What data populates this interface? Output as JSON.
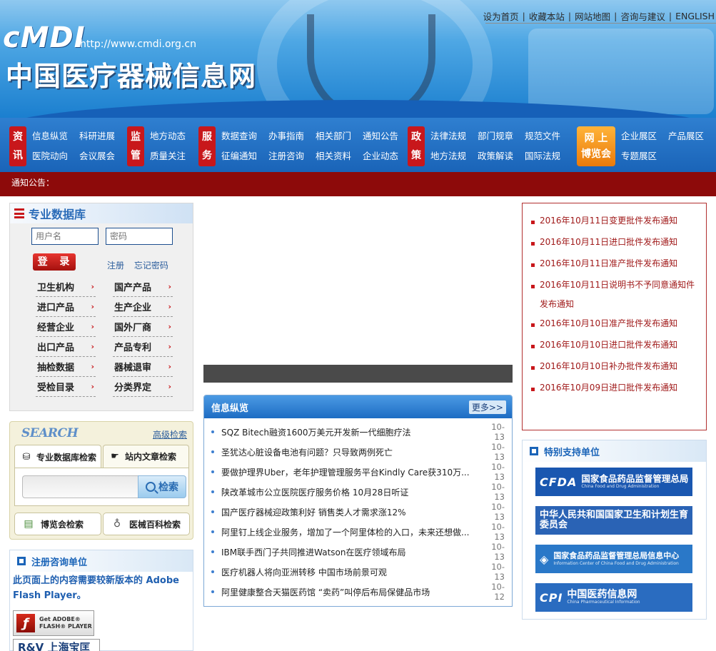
{
  "header": {
    "logo": "cMDI",
    "url": "http://www.cmdi.org.cn",
    "title": "中国医疗器械信息网",
    "top_links": [
      "设为首页",
      "收藏本站",
      "网站地图",
      "咨询与建议",
      "ENGLISH"
    ]
  },
  "nav": {
    "groups": [
      {
        "tag": [
          "资",
          "讯"
        ],
        "links": [
          "信息纵览",
          "医院动向",
          "科研进展",
          "会议展会"
        ]
      },
      {
        "tag": [
          "监",
          "管"
        ],
        "links": [
          "地方动态",
          "质量关注"
        ]
      },
      {
        "tag": [
          "服",
          "务"
        ],
        "links": [
          "数据查询",
          "征编通知",
          "办事指南",
          "注册咨询",
          "相关部门",
          "相关资料",
          "通知公告",
          "企业动态"
        ]
      },
      {
        "tag": [
          "政",
          "策"
        ],
        "links": [
          "法律法规",
          "地方法规",
          "部门规章",
          "政策解读",
          "规范文件",
          "国际法规"
        ]
      },
      {
        "tag": [
          "网 上",
          "博览会"
        ],
        "links": [
          "企业展区",
          "专题展区",
          "产品展区"
        ]
      }
    ]
  },
  "notice_bar": "通知公告：",
  "database": {
    "title": "专业数据库",
    "username_placeholder": "用户名",
    "password_placeholder": "密码",
    "login_label": "登 录",
    "register_label": "注册",
    "forgot_label": "忘记密码",
    "items": [
      "卫生机构",
      "国产产品",
      "进口产品",
      "生产企业",
      "经营企业",
      "国外厂商",
      "出口产品",
      "产品专利",
      "抽检数据",
      "器械退审",
      "受检目录",
      "分类界定"
    ]
  },
  "search": {
    "title": "SEARCH",
    "advanced": "高级检索",
    "tab_db": "专业数据库检索",
    "tab_site": "站内文章检索",
    "button": "检索",
    "expo_search": "博览会检索",
    "encyclopedia_search": "医械百科检索"
  },
  "consult": {
    "title": "注册咨询单位",
    "flash_msg": "此页面上的内容需要较新版本的 Adobe Flash Player。",
    "flash_badge_line1": "Get ADOBE®",
    "flash_badge_line2": "FLASH® PLAYER",
    "next_partner": "R&V 上海宝匡"
  },
  "news": {
    "title": "信息纵览",
    "more": "更多>>",
    "items": [
      {
        "title": "SQZ Bitech融资1600万美元开发新一代细胞疗法",
        "date": "10-13"
      },
      {
        "title": "圣犹达心脏设备电池有问题？只导致两例死亡",
        "date": "10-13"
      },
      {
        "title": "要做护理界Uber，老年护理管理服务平台Kindly Care获310万...",
        "date": "10-13"
      },
      {
        "title": "陕改革城市公立医院医疗服务价格 10月28日听证",
        "date": "10-13"
      },
      {
        "title": "国产医疗器械迎政策利好 销售类人才需求涨12%",
        "date": "10-13"
      },
      {
        "title": "阿里钉上线企业服务，增加了一个阿里体检的入口，未来还想做...",
        "date": "10-13"
      },
      {
        "title": "IBM联手西门子共同推进Watson在医疗领域布局",
        "date": "10-13"
      },
      {
        "title": "医疗机器人将向亚洲转移 中国市场前景可观",
        "date": "10-13"
      },
      {
        "title": "阿里健康整合天猫医药馆 “卖药”叫停后布局保健品市场",
        "date": "10-12"
      }
    ]
  },
  "notices": [
    "2016年10月11日变更批件发布通知",
    "2016年10月11日进口批件发布通知",
    "2016年10月11日准产批件发布通知",
    "2016年10月11日说明书不予同意通知件发布通知",
    "2016年10月10日准产批件发布通知",
    "2016年10月10日进口批件发布通知",
    "2016年10月10日补办批件发布通知",
    "2016年10月09日进口批件发布通知"
  ],
  "support": {
    "title": "特别支持单位",
    "partners": [
      {
        "logo": "CFDA",
        "name": "国家食品药品监督管理总局",
        "sub": "China Food and Drug Administration",
        "color": "#1a57b0"
      },
      {
        "logo": "",
        "name": "中华人民共和国国家卫生和计划生育委员会",
        "sub": "",
        "color": "#2a63b5"
      },
      {
        "logo": "",
        "name": "国家食品药品监督管理总局信息中心",
        "sub": "Information Center of China Food and Drug Administration",
        "color": "#2a78c8"
      },
      {
        "logo": "CPI",
        "name": "中国医药信息网",
        "sub": "China Pharmaceutical Information",
        "color": "#2a6cc0"
      }
    ]
  }
}
